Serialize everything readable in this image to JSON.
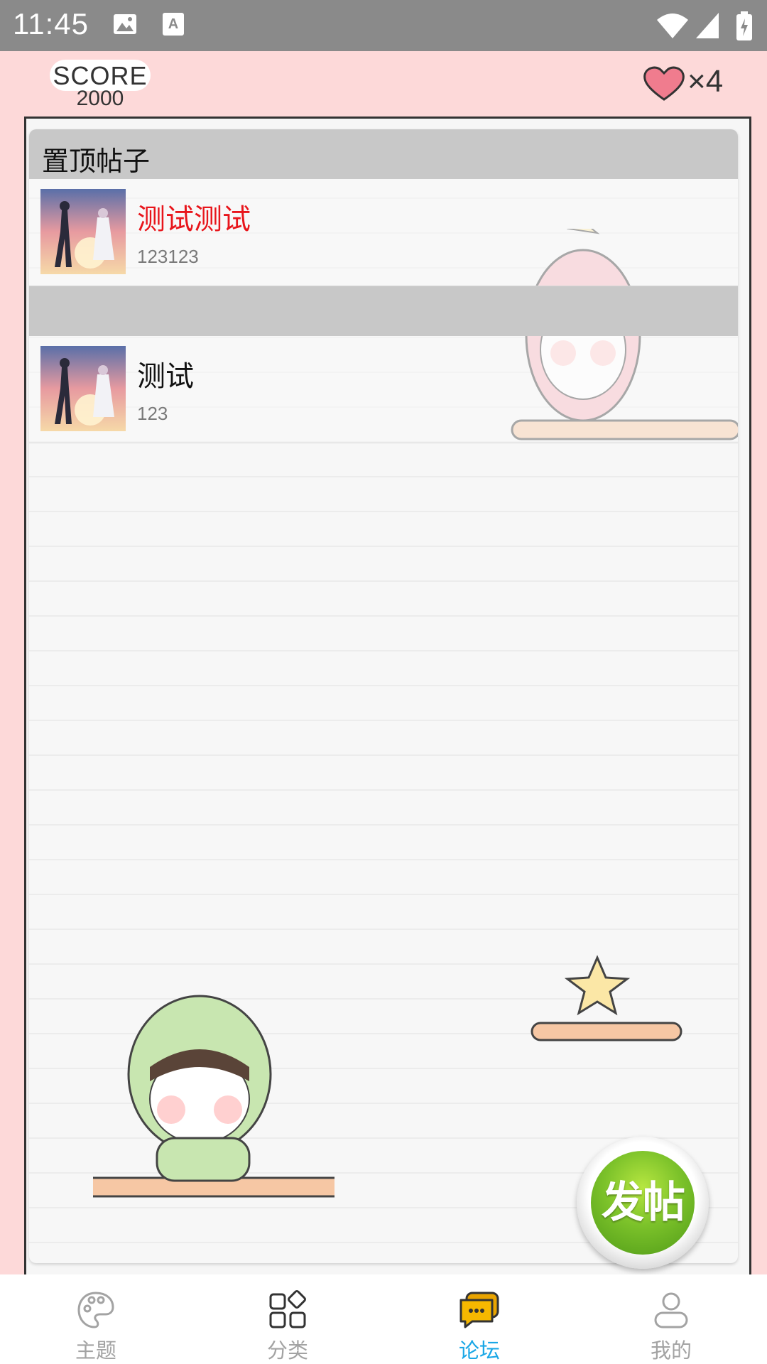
{
  "status_bar": {
    "time": "11:45"
  },
  "game_header": {
    "score_label": "SCORE",
    "score_value": "2000",
    "lives": "×4"
  },
  "sections": [
    {
      "header": "置顶帖子",
      "posts": [
        {
          "title": "测试测试",
          "subtitle": "123123",
          "title_color": "#e8151b"
        }
      ]
    },
    {
      "header": "",
      "posts": [
        {
          "title": "测试",
          "subtitle": "123",
          "title_color": "#111111"
        }
      ]
    }
  ],
  "fab": {
    "label": "发帖"
  },
  "bottom_nav": {
    "items": [
      {
        "label": "主题",
        "icon": "palette-icon"
      },
      {
        "label": "分类",
        "icon": "category-grid-icon"
      },
      {
        "label": "论坛",
        "icon": "chat-bubble-icon",
        "active": true
      },
      {
        "label": "我的",
        "icon": "person-icon"
      }
    ],
    "active_color": "#1aa7e6",
    "inactive_color": "#a3a3a3"
  }
}
